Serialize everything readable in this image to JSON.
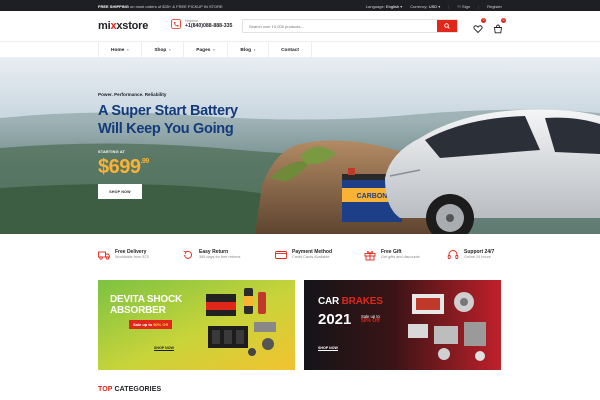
{
  "topbar": {
    "free_shipping": "FREE SHIPPING",
    "shipping_text": " on most orders of $35+ & FREE PICKUP IN STORE",
    "language_label": "Language:",
    "language_value": "English",
    "currency_label": "Currency:",
    "currency_value": "USD",
    "signin": "Sign",
    "register": "Register"
  },
  "header": {
    "logo_part1": "mi",
    "logo_x": "x",
    "logo_part2": "xstore",
    "helpline_label": "Helpline",
    "helpline_number": "+1(840)088-888-335",
    "search_placeholder": "Search over 10,000 products...",
    "wishlist_count": "0",
    "cart_count": "0"
  },
  "nav": {
    "items": [
      "Home",
      "Shop",
      "Pages",
      "Blog",
      "Contact"
    ]
  },
  "hero": {
    "kicker": "Power. Performance. Reliability",
    "title_line1": "A Super Start Battery",
    "title_line2": "Will Keep You Going",
    "starting_at": "STARTING AT",
    "price": "$699",
    "price_cents": ".99",
    "shop_now": "SHOP NOW",
    "battery_brand": "CARBON"
  },
  "features": [
    {
      "title": "Free Delivery",
      "subtitle": "Worldwide from $75",
      "icon": "truck-icon"
    },
    {
      "title": "Easy Return",
      "subtitle": "365 days for free returns",
      "icon": "return-icon"
    },
    {
      "title": "Payment Method",
      "subtitle": "Credit Cards Available",
      "icon": "card-icon"
    },
    {
      "title": "Free Gift",
      "subtitle": "Get gifts and discounts",
      "icon": "gift-icon"
    },
    {
      "title": "Support 24/7",
      "subtitle": "Online 24 hours",
      "icon": "headset-icon"
    }
  ],
  "banner1": {
    "line1": "DEVITA SHOCK",
    "line2": "ABSORBER",
    "sale_text": "Sale up to ",
    "sale_off": "50% Off",
    "shop_now": "SHOP NOW"
  },
  "banner2": {
    "line1_a": "CAR ",
    "line1_b": "BRAKES",
    "year": "2021",
    "note": "Sale up to",
    "off": "50% Off",
    "shop_now": "SHOP NOW"
  },
  "categories": {
    "title_a": "TOP ",
    "title_b": "CATEGORIES"
  },
  "colors": {
    "accent": "#e0271a",
    "navy": "#133a7a",
    "gold": "#f9b233",
    "dark": "#1e1f24"
  }
}
